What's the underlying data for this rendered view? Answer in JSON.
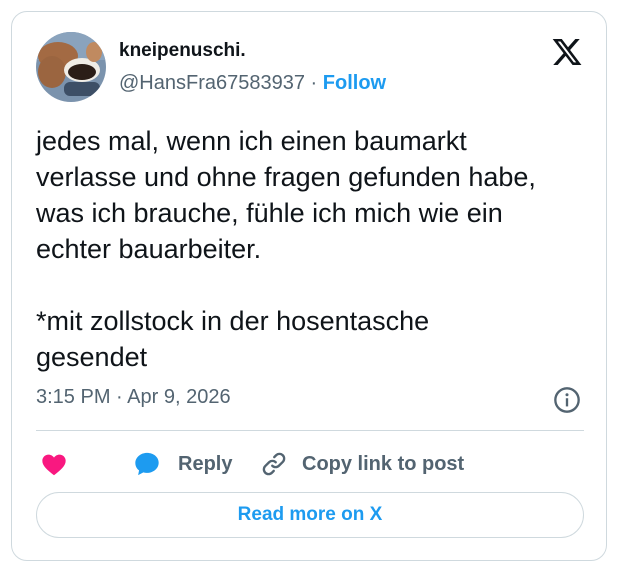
{
  "author": {
    "display_name": "kneipenuschi.",
    "handle": "@HansFra67583937",
    "separator": "·",
    "follow_label": "Follow"
  },
  "tweet": {
    "text": "jedes mal, wenn ich einen baumarkt\nverlasse und ohne fragen gefunden habe,\nwas ich brauche, fühle ich mich wie ein\nechter bauarbeiter.\n\n*mit zollstock in der hosentasche\ngesendet",
    "time": "3:15 PM",
    "meta_separator": "·",
    "date": "Apr 9, 2026"
  },
  "actions": {
    "reply_label": "Reply",
    "copy_link_label": "Copy link to post"
  },
  "footer": {
    "read_more_label": "Read more on X"
  },
  "icons": {
    "logo": "x-logo-icon",
    "info": "info-icon",
    "like": "heart-icon",
    "reply": "speech-bubble-icon",
    "copy": "link-icon"
  },
  "colors": {
    "accent": "#1d9bf0",
    "heart": "#f91880",
    "text": "#0f1419",
    "secondary": "#536471",
    "border": "#cfd9de"
  }
}
